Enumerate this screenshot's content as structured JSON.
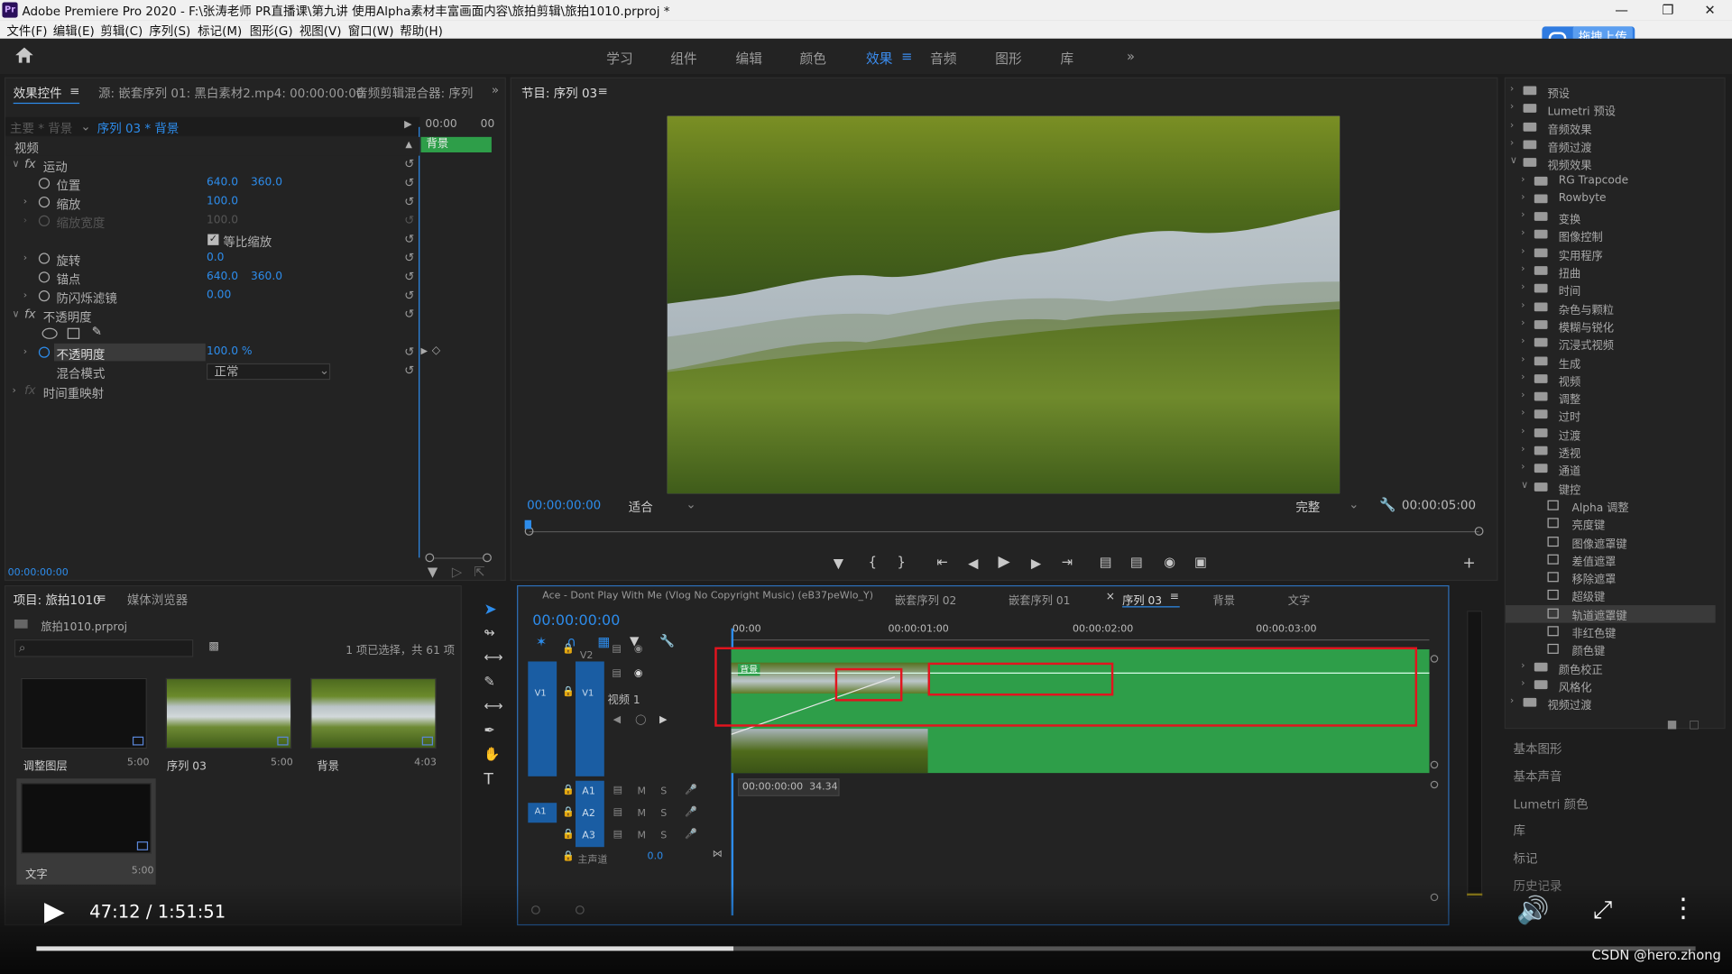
{
  "window": {
    "title": "Adobe Premiere Pro 2020 - F:\\张涛老师  PR直播课\\第九讲 使用Alpha素材丰富画面内容\\旅拍剪辑\\旅拍1010.prproj *",
    "icon": "Pr"
  },
  "menu": [
    "文件(F)",
    "编辑(E)",
    "剪辑(C)",
    "序列(S)",
    "标记(M)",
    "图形(G)",
    "视图(V)",
    "窗口(W)",
    "帮助(H)"
  ],
  "upload_button": "拖拽上传",
  "workspaces": [
    "学习",
    "组件",
    "编辑",
    "颜色",
    "效果",
    "音频",
    "图形",
    "库"
  ],
  "effect_controls": {
    "tabs": [
      "效果控件",
      "源: 嵌套序列 01: 黑白素材2.mp4: 00:00:00:00",
      "音频剪辑混合器: 序列"
    ],
    "master": "主要 * 背景",
    "sequence": "序列 03 * 背景",
    "ruler": [
      "00:00",
      "00"
    ],
    "clip_label": "背景",
    "video_header": "视频",
    "motion": "运动",
    "position_label": "位置",
    "position_x": "640.0",
    "position_y": "360.0",
    "scale_label": "缩放",
    "scale": "100.0",
    "scale_width_label": "缩放宽度",
    "scale_width": "100.0",
    "uniform_label": "等比缩放",
    "rotation_label": "旋转",
    "rotation": "0.0",
    "anchor_label": "锚点",
    "anchor_x": "640.0",
    "anchor_y": "360.0",
    "flicker_label": "防闪烁滤镜",
    "flicker": "0.00",
    "opacity_group": "不透明度",
    "opacity_label": "不透明度",
    "opacity": "100.0 %",
    "blend_label": "混合模式",
    "blend": "正常",
    "time_remap": "时间重映射",
    "timecode": "00:00:00:00"
  },
  "program": {
    "title": "节目: 序列 03",
    "timecode": "00:00:00:00",
    "fit": "适合",
    "quality": "完整",
    "duration": "00:00:05:00"
  },
  "project": {
    "tabs": [
      "项目: 旅拍1010",
      "媒体浏览器"
    ],
    "file": "旅拍1010.prproj",
    "selection": "1 项已选择，共 61 项",
    "items": [
      {
        "name": "调整图层",
        "dur": "5:00"
      },
      {
        "name": "序列 03",
        "dur": "5:00"
      },
      {
        "name": "背景",
        "dur": "4:03"
      },
      {
        "name": "文字",
        "dur": "5:00"
      }
    ]
  },
  "timeline": {
    "tabs": [
      "Ace - Dont Play With Me (Vlog No Copyright Music) (eB37peWlo_Y)",
      "嵌套序列 02",
      "嵌套序列 01",
      "序列 03",
      "背景",
      "文字"
    ],
    "timecode": "00:00:00:00",
    "ruler": [
      "00:00",
      "00:00:01:00",
      "00:00:02:00",
      "00:00:03:00"
    ],
    "tracks": {
      "v2": "V2",
      "v1": "V1",
      "v1_name": "视频 1",
      "a1": "A1",
      "a2": "A2",
      "a3": "A3",
      "master": "主声道",
      "master_val": "0.0"
    },
    "clip_label": "背景",
    "tooltip": [
      "00:00:00:00",
      "34.34"
    ]
  },
  "effects": {
    "top": [
      "预设",
      "Lumetri 预设",
      "音频效果",
      "音频过渡",
      "视频效果"
    ],
    "video_effects": [
      "RG Trapcode",
      "Rowbyte",
      "变换",
      "图像控制",
      "实用程序",
      "扭曲",
      "时间",
      "杂色与颗粒",
      "模糊与锐化",
      "沉浸式视频",
      "生成",
      "视频",
      "调整",
      "过时",
      "过渡",
      "透视",
      "通道",
      "键控"
    ],
    "keying": [
      "Alpha 调整",
      "亮度键",
      "图像遮罩键",
      "差值遮罩",
      "移除遮罩",
      "超级键",
      "轨道遮罩键",
      "非红色键",
      "颜色键"
    ],
    "after": [
      "颜色校正",
      "风格化"
    ],
    "last": "视频过渡",
    "panels": [
      "基本图形",
      "基本声音",
      "Lumetri 颜色",
      "库",
      "标记",
      "历史记录"
    ]
  },
  "player": {
    "time": "47:12 / 1:51:51",
    "progress": 0.42,
    "watermark": "CSDN @hero.zhong"
  }
}
